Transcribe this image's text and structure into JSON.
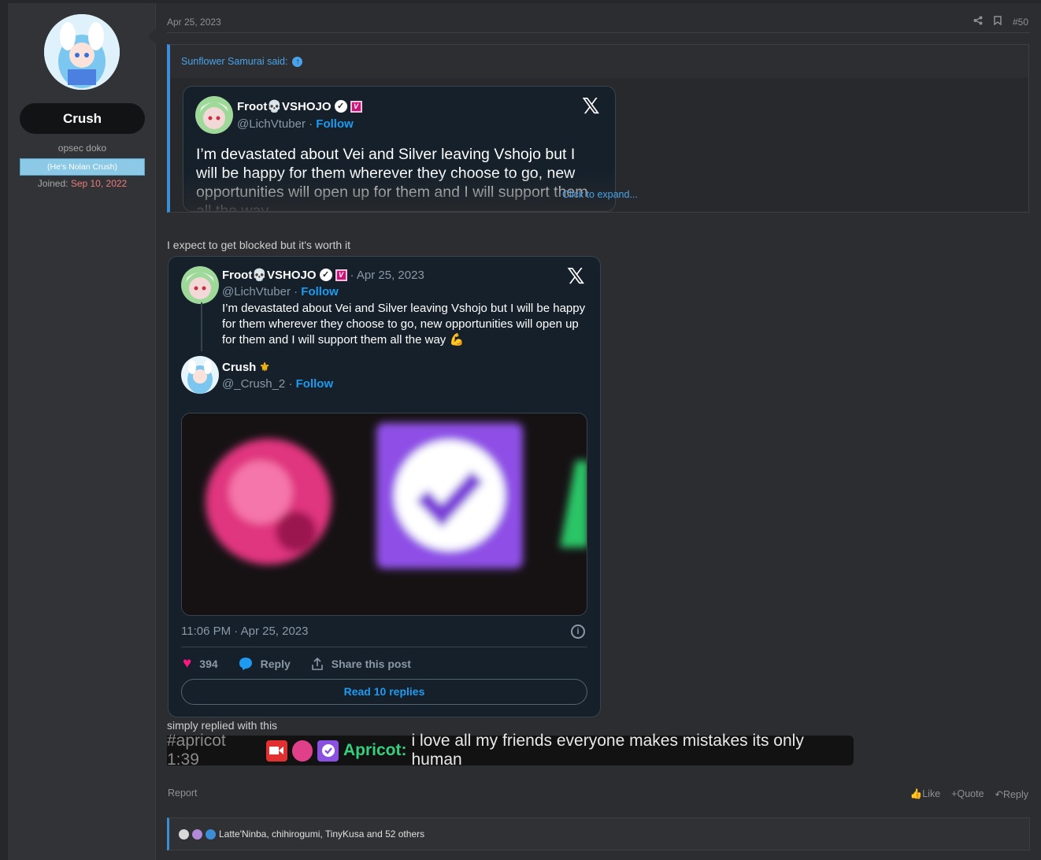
{
  "user": {
    "name": "Crush",
    "title": "opsec doko",
    "banner": "(He's Nolan Crush)",
    "joined_label": "Joined:",
    "joined_value": "Sep 10, 2022"
  },
  "post": {
    "date": "Apr 25, 2023",
    "number": "#50",
    "quote": {
      "author_said": "Sunflower Samurai said:",
      "expand": "Click to expand..."
    },
    "body": "I expect to get blocked but it's worth it",
    "text2": "simply replied with this",
    "report": "Report",
    "actions": {
      "like": "Like",
      "quote": "Quote",
      "reply": "Reply"
    },
    "reactions_text": "Latte'Ninba, chihirogumi, TinyKusa and 52 others"
  },
  "tweet1": {
    "name_prefix": "Froot",
    "name_suffix": "VSHOJO",
    "handle": "@LichVtuber",
    "follow": "Follow",
    "text": "I’m devastated about Vei and Silver leaving Vshojo but I will be happy for them wherever they choose to go, new opportunities will open up for them and I will support them all the way"
  },
  "tweet2": {
    "name_prefix": "Froot",
    "name_suffix": "VSHOJO",
    "date": "· Apr 25, 2023",
    "handle": "@LichVtuber",
    "follow": "Follow",
    "text": "I’m devastated about Vei and Silver leaving Vshojo but I will be happy for them wherever they choose to go, new opportunities will open up for them and I will support them all the way 💪",
    "reply_name": "Crush",
    "reply_handle": "@_Crush_2",
    "reply_follow": "Follow",
    "timestamp": "11:06 PM · Apr 25, 2023",
    "likes": "394",
    "reply_label": "Reply",
    "share_label": "Share this post",
    "read_replies": "Read 10 replies"
  },
  "chat": {
    "channel": "#apricot 1:39",
    "username": "Apricot:",
    "message": "i love all my friends everyone makes mistakes its only human"
  },
  "colors": {
    "accent_blue": "#3b8dd6",
    "twitter_blue": "#1d9bf0",
    "like_pink": "#f91880",
    "chat_green": "#35d07f"
  }
}
